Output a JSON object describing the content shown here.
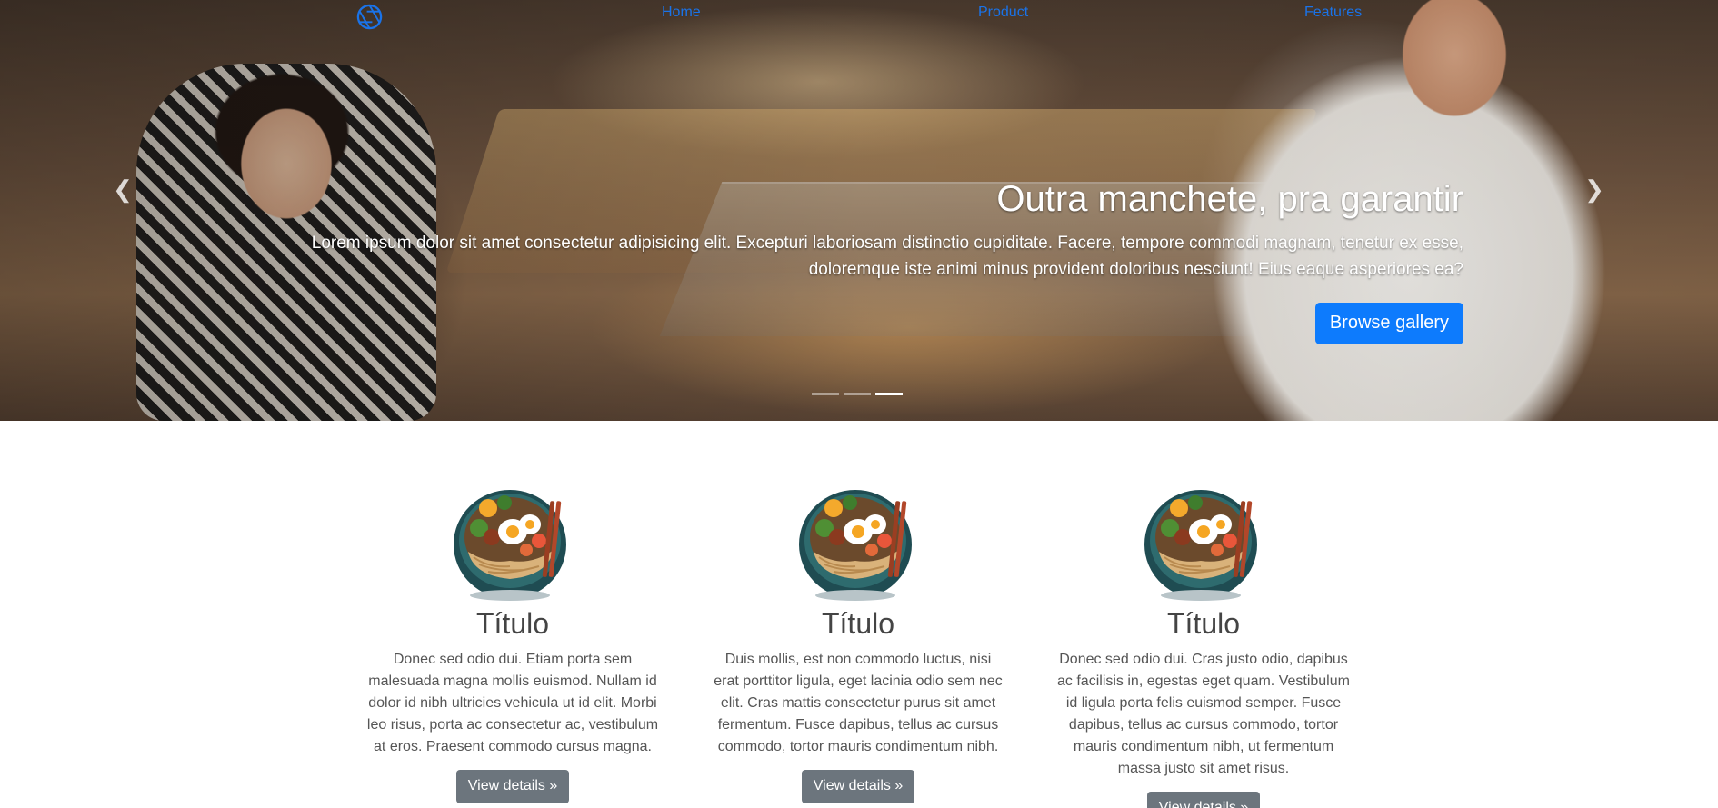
{
  "nav": {
    "logo_icon": "aperture-icon",
    "links": [
      {
        "label": "Home"
      },
      {
        "label": "Product"
      },
      {
        "label": "Features"
      }
    ],
    "link_color": "#1a73e8"
  },
  "carousel": {
    "prev_icon": "chevron-left-icon",
    "next_icon": "chevron-right-icon",
    "prev_glyph": "❮",
    "next_glyph": "❯",
    "title": "Outra manchete, pra garantir",
    "text": "Lorem ipsum dolor sit amet consectetur adipisicing elit. Excepturi laboriosam distinctio cupiditate. Facere, tempore commodi magnam, tenetur ex esse, doloremque iste animi minus provident doloribus nesciunt! Eius eaque asperiores ea?",
    "button_label": "Browse gallery",
    "button_color": "#0d7bfd",
    "slide_count": 3,
    "active_slide": 3
  },
  "features": {
    "image_icon": "ramen-bowl-icon",
    "items": [
      {
        "title": "Título",
        "text": "Donec sed odio dui. Etiam porta sem malesuada magna mollis euismod. Nullam id dolor id nibh ultricies vehicula ut id elit. Morbi leo risus, porta ac consectetur ac, vestibulum at eros. Praesent commodo cursus magna.",
        "button_label": "View details »"
      },
      {
        "title": "Título",
        "text": "Duis mollis, est non commodo luctus, nisi erat porttitor ligula, eget lacinia odio sem nec elit. Cras mattis consectetur purus sit amet fermentum. Fusce dapibus, tellus ac cursus commodo, tortor mauris condimentum nibh.",
        "button_label": "View details »"
      },
      {
        "title": "Título",
        "text": "Donec sed odio dui. Cras justo odio, dapibus ac facilisis in, egestas eget quam. Vestibulum id ligula porta felis euismod semper. Fusce dapibus, tellus ac cursus commodo, tortor mauris condimentum nibh, ut fermentum massa justo sit amet risus.",
        "button_label": "View details »"
      }
    ],
    "button_color": "#6c757d"
  }
}
